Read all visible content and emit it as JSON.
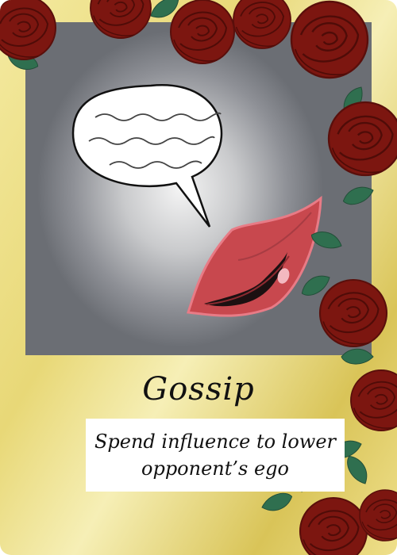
{
  "card": {
    "title": "Gossip",
    "description": "Spend influence to lower opponent’s ego"
  },
  "colors": {
    "frame_gold": "#e8d877",
    "art_gray": "#8e9096",
    "rose_red": "#8b1a14",
    "leaf_green": "#2f6f4f",
    "lip_red": "#c8484e"
  },
  "icons": [
    "speech-bubble-icon",
    "lips-icon",
    "rose-icon",
    "leaf-icon"
  ]
}
